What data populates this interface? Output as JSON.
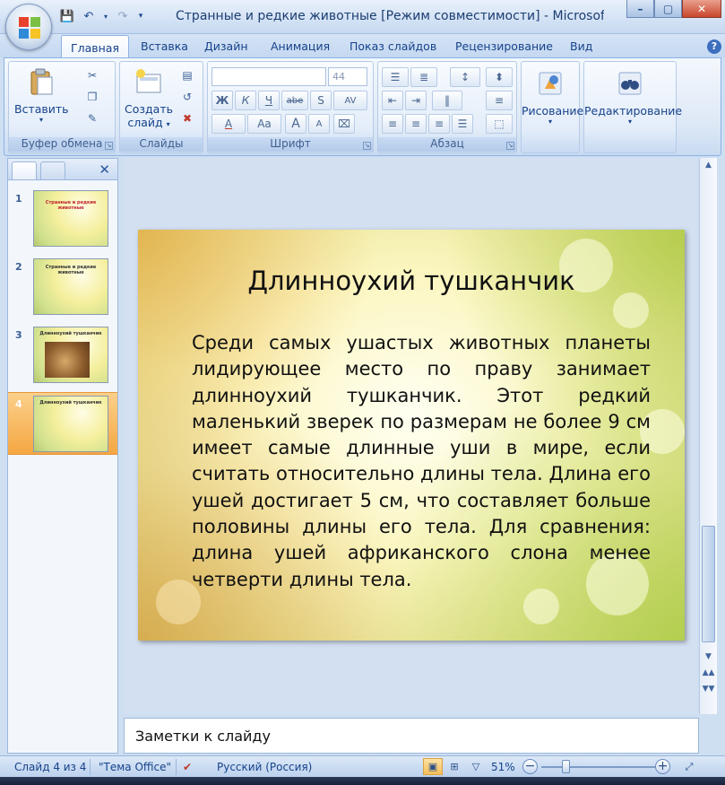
{
  "window": {
    "title": "Странные и редкие животные [Режим совместимости] - Microsof...",
    "controls": [
      "minimize",
      "restore",
      "close"
    ]
  },
  "quick_access": [
    "save-icon",
    "undo-icon",
    "redo-icon",
    "customize-icon"
  ],
  "tabs": [
    "Главная",
    "Вставка",
    "Дизайн",
    "Анимация",
    "Показ слайдов",
    "Рецензирование",
    "Вид"
  ],
  "active_tab": "Главная",
  "ribbon": {
    "clipboard": {
      "label": "Буфер обмена",
      "paste": "Вставить"
    },
    "slides": {
      "label": "Слайды",
      "new_slide_line1": "Создать",
      "new_slide_line2": "слайд"
    },
    "font": {
      "label": "Шрифт",
      "font_name": "",
      "font_size": "44",
      "bold": "Ж",
      "italic": "К",
      "underline": "Ч",
      "strike": "abe",
      "shadow": "S",
      "spacing": "AV",
      "color": "A",
      "case": "Aa",
      "grow": "A",
      "shrink": "A"
    },
    "paragraph": {
      "label": "Абзац"
    },
    "drawing": {
      "label": "Рисование"
    },
    "editing": {
      "label": "Редактирование"
    }
  },
  "slides": [
    {
      "num": "1",
      "title": "Странные и редкие животные"
    },
    {
      "num": "2",
      "title": "Странные и редкие животные"
    },
    {
      "num": "3",
      "title": "Длинноухий тушканчик"
    },
    {
      "num": "4",
      "title": "Длинноухий тушканчик"
    }
  ],
  "selected_slide": 4,
  "current_slide": {
    "title": "Длинноухий тушканчик",
    "body": "Среди самых ушастых животных планеты лидирующее место по праву занимает длинноухий тушканчик. Этот редкий маленький зверек по размерам не более 9 см имеет самые длинные уши в мире, если считать относительно длины тела. Длина его ушей достигает 5 см, что составляет больше половины длины его тела. Для сравнения: длина ушей африканского слона менее четверти длины тела."
  },
  "notes_placeholder": "Заметки к слайду",
  "status": {
    "slide_counter": "Слайд 4 из 4",
    "theme": "\"Тема Office\"",
    "language": "Русский (Россия)",
    "zoom": "51%",
    "zoom_value": 0.51
  },
  "colors": {
    "accent": "#15428b",
    "ribbon_bg": "#dde8f6",
    "selected_thumb": "#f5a742",
    "close_btn": "#c9462c"
  }
}
